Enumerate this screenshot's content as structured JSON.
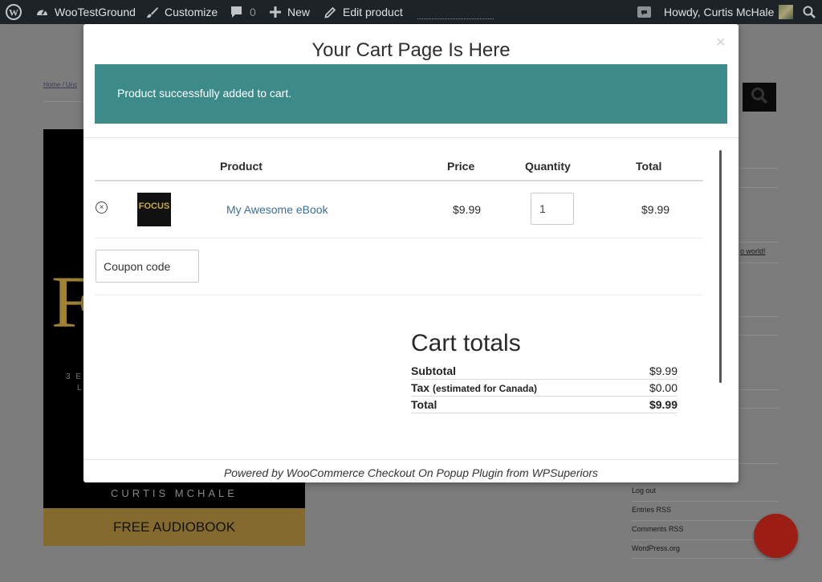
{
  "admin_bar": {
    "site_name": "WooTestGround",
    "customize": "Customize",
    "comments_count": "0",
    "new": "New",
    "edit_product": "Edit product",
    "howdy": "Howdy, Curtis McHale"
  },
  "background": {
    "breadcrumb": "Home / Unc",
    "book_letters": "F",
    "book_subtitle_line1": "3 E",
    "book_subtitle_line2": "L",
    "book_author": "CURTIS MCHALE",
    "audiobook_label": "FREE AUDIOBOOK",
    "sidebar_fragment": "o world!",
    "sidebar_links": [
      "Log out",
      "Entries RSS",
      "Comments RSS",
      "WordPress.org"
    ]
  },
  "modal": {
    "title": "Your Cart Page Is Here",
    "close": "×",
    "notice": "Product successfully added to cart.",
    "table": {
      "headers": {
        "product": "Product",
        "price": "Price",
        "quantity": "Quantity",
        "total": "Total"
      },
      "rows": [
        {
          "thumb_text": "FOCUS",
          "name": "My Awesome eBook",
          "price": "$9.99",
          "quantity": "1",
          "total": "$9.99"
        }
      ]
    },
    "coupon_placeholder": "Coupon code",
    "cart_totals": {
      "title": "Cart totals",
      "subtotal_label": "Subtotal",
      "subtotal_value": "$9.99",
      "tax_label": "Tax",
      "tax_note": "(estimated for Canada)",
      "tax_value": "$0.00",
      "total_label": "Total",
      "total_value": "$9.99"
    },
    "footer": "Powered by WooCommerce Checkout On Popup Plugin from WPSuperiors"
  }
}
